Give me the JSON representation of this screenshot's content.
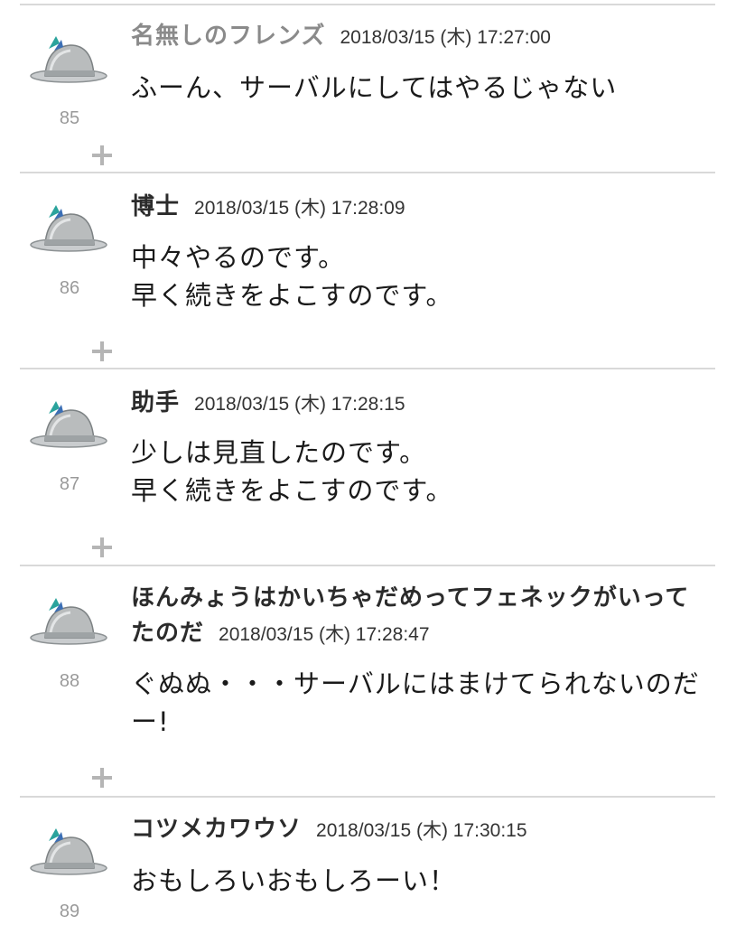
{
  "posts": [
    {
      "number": "85",
      "author": "名無しのフレンズ",
      "timestamp": "2018/03/15 (木) 17:27:00",
      "body": "ふーん、サーバルにしてはやるじゃない"
    },
    {
      "number": "86",
      "author": "博士",
      "timestamp": "2018/03/15 (木) 17:28:09",
      "body": "中々やるのです。\n早く続きをよこすのです。"
    },
    {
      "number": "87",
      "author": "助手",
      "timestamp": "2018/03/15 (木) 17:28:15",
      "body": "少しは見直したのです。\n早く続きをよこすのです。"
    },
    {
      "number": "88",
      "author": "ほんみょうはかいちゃだめってフェネックがいってたのだ",
      "timestamp": "2018/03/15 (木) 17:28:47",
      "body": "ぐぬぬ・・・サーバルにはまけてられないのだー!"
    },
    {
      "number": "89",
      "author": "コツメカワウソ",
      "timestamp": "2018/03/15 (木) 17:30:15",
      "body": "おもしろいおもしろーい！"
    }
  ],
  "icons": {
    "avatar": "helmet-avatar-icon",
    "expand": "plus-icon"
  },
  "colors": {
    "divider": "#d9d9d9",
    "anon_author": "#8a8a8a",
    "post_number": "#9a9a9a",
    "plus": "#b5b5b5"
  }
}
